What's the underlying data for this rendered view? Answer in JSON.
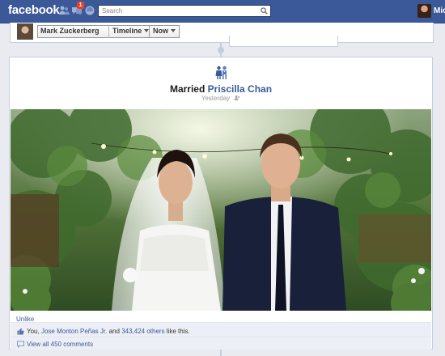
{
  "topbar": {
    "logo": "facebook",
    "notifications_count": "1",
    "search_placeholder": "Search",
    "profile_name": "Mich"
  },
  "timeline_nav": {
    "name": "Mark Zuckerberg",
    "timeline_label": "Timeline",
    "now_label": "Now"
  },
  "life_event": {
    "title_prefix": "Married",
    "partner_name": "Priscilla Chan",
    "time": "Yesterday",
    "unlike_label": "Unlike",
    "likes": {
      "you": "You,",
      "friend": "Jose Monton Peñas Jr.",
      "and": "and",
      "others": "343,424 others",
      "suffix": "like this."
    },
    "view_comments": "View all 450 comments"
  },
  "colors": {
    "brand": "#3b5998",
    "page_background": "#e9ebf0",
    "notification_badge": "#f03d25"
  },
  "icons": [
    "friends-icon",
    "messages-icon",
    "notifications-icon",
    "search-icon",
    "wedding-icon",
    "audience-icon",
    "like-thumb-icon",
    "comment-icon",
    "chevron-down-icon"
  ]
}
